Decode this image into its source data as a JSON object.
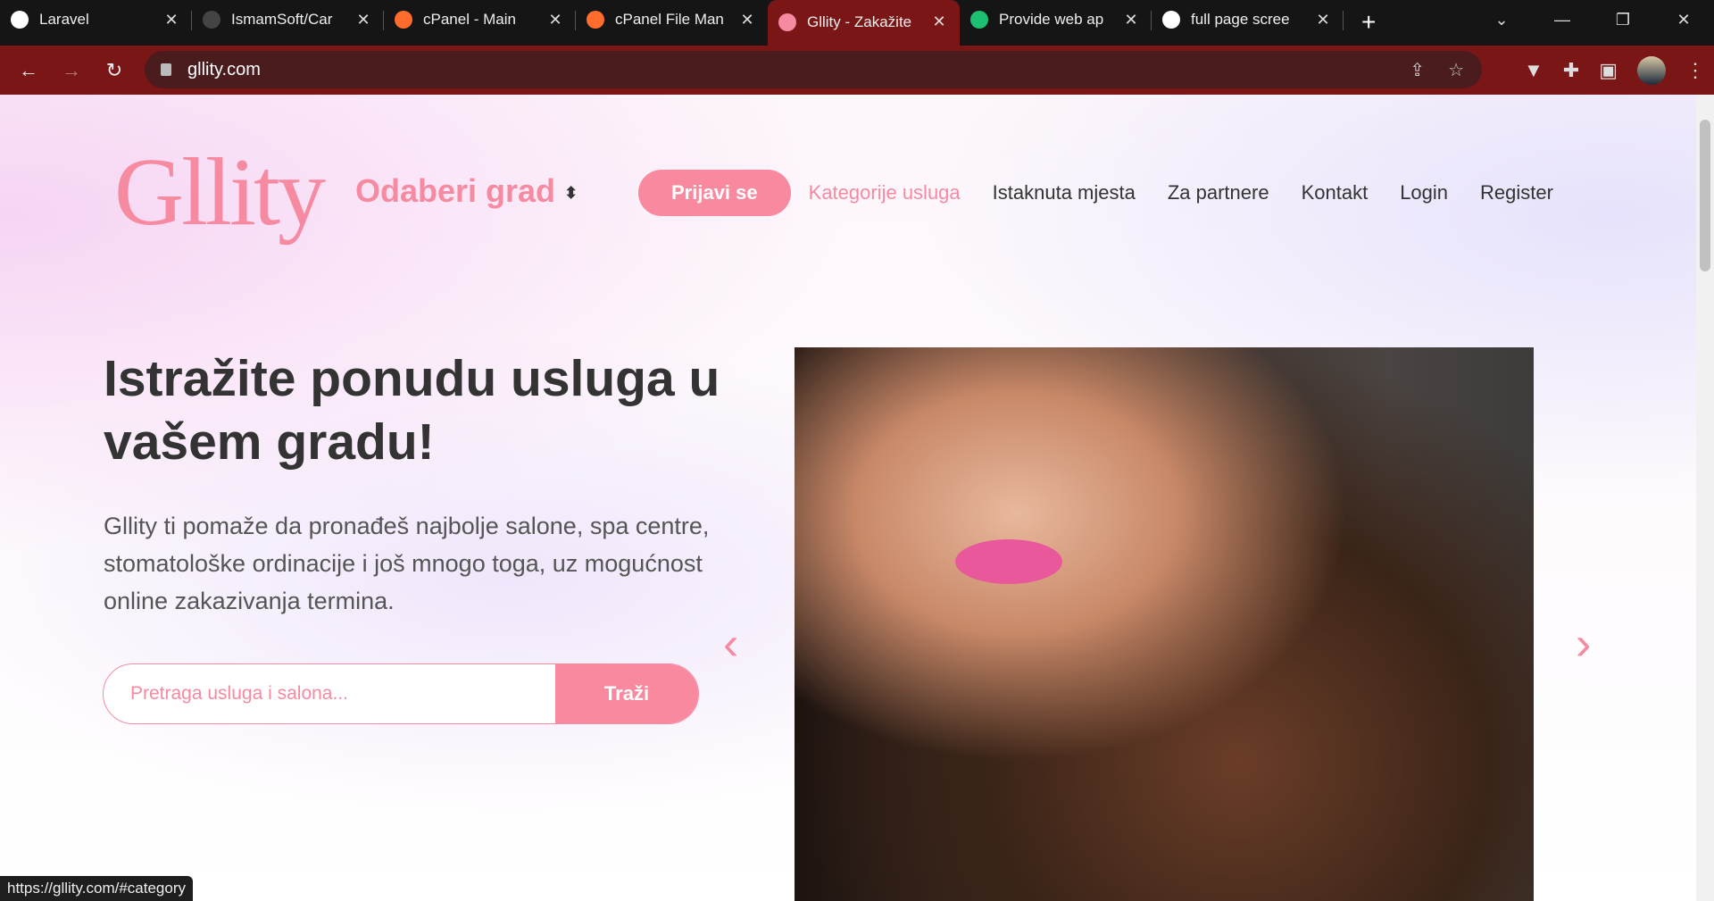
{
  "browser": {
    "tabs": [
      {
        "title": "Laravel",
        "icon": "globe-icon",
        "color": "#ffffff"
      },
      {
        "title": "IsmamSoft/Car",
        "icon": "github-icon",
        "color": "#444444"
      },
      {
        "title": "cPanel - Main",
        "icon": "cpanel-icon",
        "color": "#ff6c2c"
      },
      {
        "title": "cPanel File Man",
        "icon": "cpanel-icon",
        "color": "#ff6c2c"
      },
      {
        "title": "Gllity - Zakažite",
        "icon": "gllity-icon",
        "color": "#f58aa0",
        "active": true
      },
      {
        "title": "Provide web ap",
        "icon": "fiverr-icon",
        "color": "#1dbf73"
      },
      {
        "title": "full page scree",
        "icon": "google-icon",
        "color": "#ffffff"
      }
    ],
    "url": "gllity.com",
    "status_url": "https://gllity.com/#category"
  },
  "header": {
    "logo": "Gllity",
    "city_select": "Odaberi grad",
    "nav": {
      "signin": "Prijavi se",
      "categories": "Kategorije usluga",
      "featured": "Istaknuta mjesta",
      "partners": "Za partnere",
      "contact": "Kontakt",
      "login": "Login",
      "register": "Register"
    }
  },
  "hero": {
    "title": "Istražite ponudu usluga u vašem gradu!",
    "lead": "Gllity ti pomaže da pronađeš najbolje salone, spa centre, stomatološke ordinacije i još mnogo toga, uz mogućnost online zakazivanja termina.",
    "search_placeholder": "Pretraga usluga i salona...",
    "search_button": "Traži"
  },
  "colors": {
    "accent": "#f58aa0",
    "browser_frame": "#7a1616"
  }
}
